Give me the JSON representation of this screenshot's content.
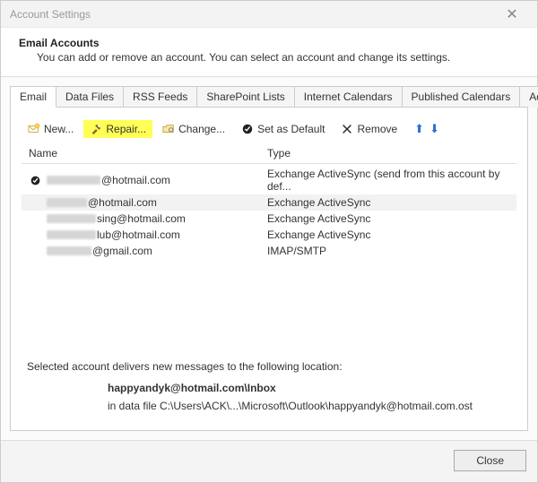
{
  "window": {
    "title": "Account Settings"
  },
  "header": {
    "heading": "Email Accounts",
    "subheading": "You can add or remove an account. You can select an account and change its settings."
  },
  "tabs": [
    {
      "label": "Email",
      "active": true
    },
    {
      "label": "Data Files"
    },
    {
      "label": "RSS Feeds"
    },
    {
      "label": "SharePoint Lists"
    },
    {
      "label": "Internet Calendars"
    },
    {
      "label": "Published Calendars"
    },
    {
      "label": "Address Books"
    }
  ],
  "toolbar": {
    "new": "New...",
    "repair": "Repair...",
    "change": "Change...",
    "setdefault": "Set as Default",
    "remove": "Remove"
  },
  "columns": {
    "name": "Name",
    "type": "Type"
  },
  "accounts": [
    {
      "suffix": "@hotmail.com",
      "type": "Exchange ActiveSync (send from this account by def...",
      "default": true
    },
    {
      "suffix": "@hotmail.com",
      "type": "Exchange ActiveSync",
      "selected": true
    },
    {
      "suffix": "sing@hotmail.com",
      "type": "Exchange ActiveSync"
    },
    {
      "suffix": "lub@hotmail.com",
      "type": "Exchange ActiveSync"
    },
    {
      "suffix": "@gmail.com",
      "type": "IMAP/SMTP"
    }
  ],
  "delivery": {
    "label": "Selected account delivers new messages to the following location:",
    "location_bold": "happyandyk@hotmail.com\\Inbox",
    "location_path": "in data file C:\\Users\\ACK\\...\\Microsoft\\Outlook\\happyandyk@hotmail.com.ost"
  },
  "footer": {
    "close": "Close"
  }
}
